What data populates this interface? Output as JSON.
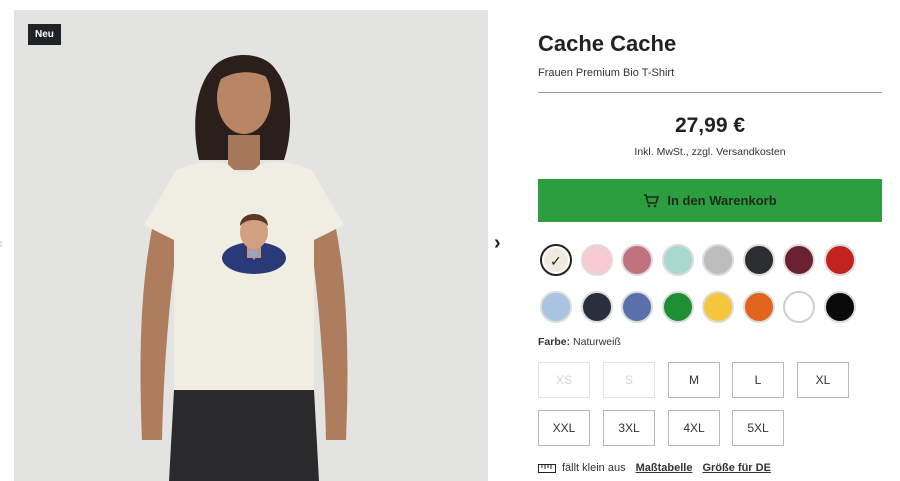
{
  "badge": "Neu",
  "product": {
    "title": "Cache Cache",
    "subtitle": "Frauen Premium Bio T-Shirt",
    "price": "27,99 €",
    "tax_note": "Inkl. MwSt., zzgl. Versandkosten",
    "cart_label": "In den Warenkorb"
  },
  "colors": {
    "label": "Farbe:",
    "selected": "Naturweiß",
    "swatches": [
      "#efebe0",
      "#f7c9d0",
      "#c0737f",
      "#a8d8ce",
      "#bdbdbd",
      "#2b2d2f",
      "#6a2232",
      "#c42121",
      "#a8c4e0",
      "#2a2f3d",
      "#5871a8",
      "#1e8f32",
      "#f4c63c",
      "#e0641c",
      "#ffffff",
      "#0a0a0a"
    ]
  },
  "sizes": [
    "XS",
    "S",
    "M",
    "L",
    "XL",
    "XXL",
    "3XL",
    "4XL",
    "5XL"
  ],
  "size_notes": {
    "fit": "fällt klein aus",
    "size_chart": "Maßtabelle",
    "size_de": "Größe für DE"
  },
  "icons": {
    "cart": "cart-icon",
    "ruler": "ruler-icon",
    "arrow_left": "chevron-left-icon",
    "arrow_right": "chevron-right-icon",
    "check": "check-icon"
  }
}
